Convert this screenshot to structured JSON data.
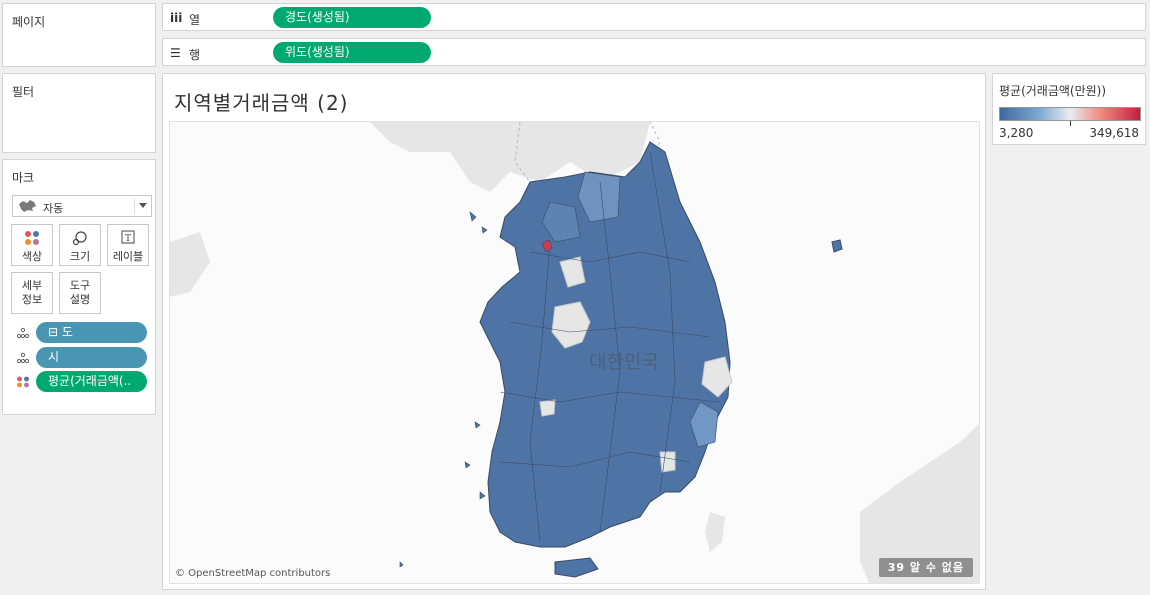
{
  "pages": {
    "title": "페이지"
  },
  "filters": {
    "title": "필터"
  },
  "columns_shelf": {
    "icon": "iii",
    "label": "열",
    "pill": "경도(생성됨)"
  },
  "rows_shelf": {
    "icon": "☰",
    "label": "행",
    "pill": "위도(생성됨)"
  },
  "marks": {
    "title": "마크",
    "mark_type": "자동",
    "buttons": {
      "color": "색상",
      "size": "크기",
      "label": "레이블",
      "detail": "세부\n정보",
      "tooltip": "도구\n설명"
    },
    "fields": [
      {
        "icon": "detail-icon",
        "label": "⊟ 도",
        "color": "#4996b2"
      },
      {
        "icon": "detail-icon",
        "label": "시",
        "color": "#4996b2"
      },
      {
        "icon": "color-icon",
        "label": "평균(거래금액(..",
        "color": "#00a971"
      }
    ]
  },
  "sheet": {
    "title": "지역별거래금액 (2)",
    "country_label": "대한민국",
    "attribution": "© OpenStreetMap contributors",
    "unknown_badge": "39 알 수 없음"
  },
  "legend": {
    "title": "평균(거래금액(만원))",
    "min": "3,280",
    "max": "349,618",
    "colors": {
      "low": "#3c6aa0",
      "mid": "#e8ecef",
      "high": "#c21f3f"
    }
  },
  "colors": {
    "map_fill": "#4e74a6",
    "map_border": "#3b4a63",
    "land": "#e6e6e6",
    "highlight": "#d0394e"
  }
}
